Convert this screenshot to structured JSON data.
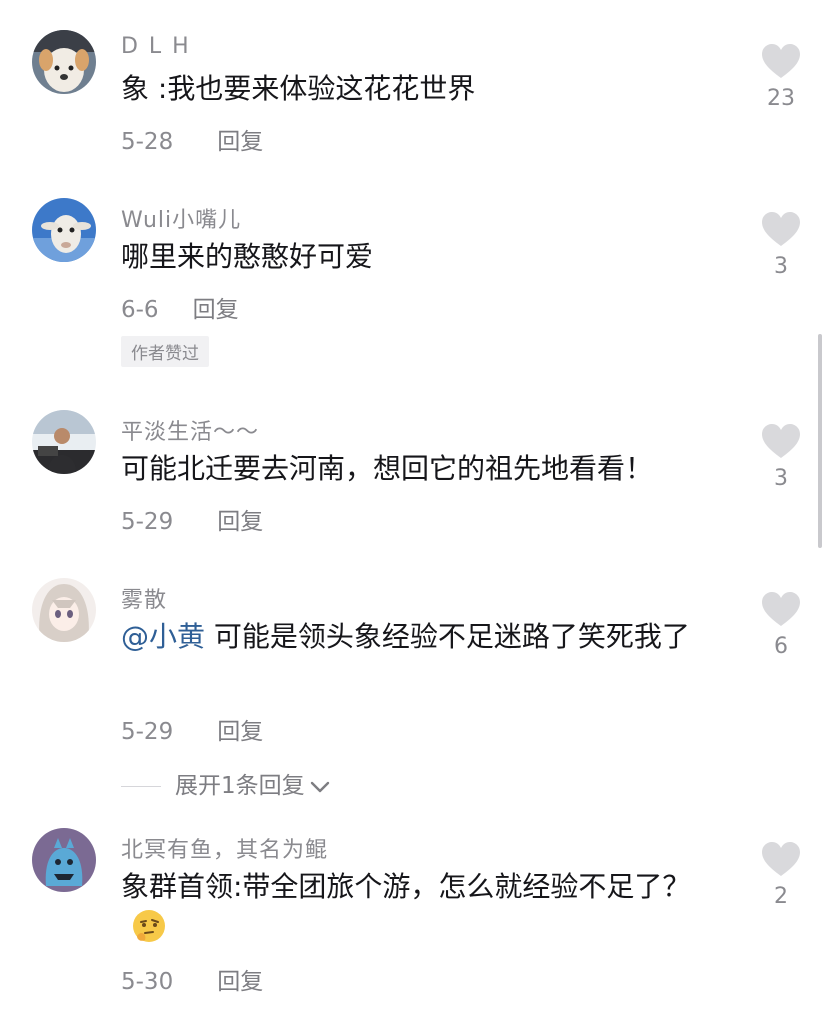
{
  "comments": [
    {
      "username": "D L H",
      "text": "象 :我也要来体验这花花世界",
      "date": "5-28",
      "reply": "回复",
      "likes": "23"
    },
    {
      "username": "Wuli小嘴儿",
      "text": "哪里来的憨憨好可爱",
      "date": "6-6",
      "reply": "回复",
      "likes": "3",
      "badge": "作者赞过"
    },
    {
      "username": "平淡生活～～",
      "text": "可能北迁要去河南，想回它的祖先地看看！",
      "date": "5-29",
      "reply": "回复",
      "likes": "3"
    },
    {
      "username": "雾散",
      "mention": "@小黄",
      "text": " 可能是领头象经验不足迷路了笑死我了",
      "date": "5-29",
      "reply": "回复",
      "likes": "6",
      "expand": "展开1条回复"
    },
    {
      "username": "北冥有鱼，其名为鲲",
      "text": "象群首领:带全团旅个游，怎么就经验不足了？",
      "date": "5-30",
      "reply": "回复",
      "likes": "2"
    }
  ],
  "icons": {
    "like": "heart-icon",
    "expand": "chevron-down-icon",
    "emoji": "thinking-face-icon"
  },
  "colors": {
    "background": "#ffffff",
    "text": "#16161a",
    "secondary": "#8a8a8f",
    "mention": "#2f5f96",
    "heart": "#d9d9dc"
  }
}
